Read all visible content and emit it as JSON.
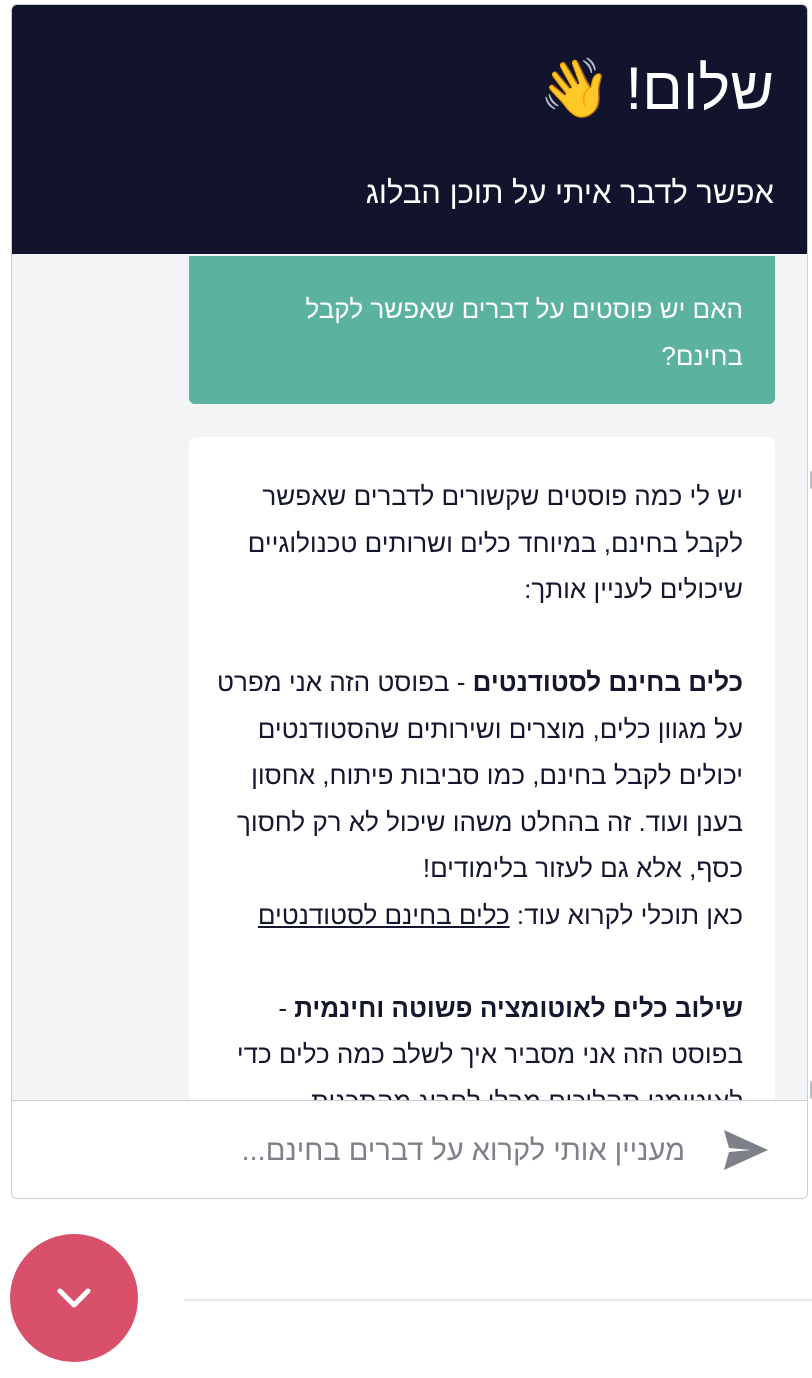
{
  "header": {
    "greeting": "שלום!",
    "wave_icon": "👋",
    "subtitle": "אפשר לדבר איתי על תוכן הבלוג"
  },
  "messages": {
    "user_question": "האם יש פוסטים על דברים שאפשר לקבל בחינם?",
    "bot_reply": {
      "intro": "יש לי כמה פוסטים שקשורים לדברים שאפשר לקבל בחינם, במיוחד כלים ושרותים טכנולוגיים שיכולים לעניין אותך:",
      "items": [
        {
          "title": "כלים בחינם לסטודנטים",
          "separator": " - ",
          "description": "בפוסט הזה אני מפרט על מגוון כלים, מוצרים ושירותים שהסטודנטים יכולים לקבל בחינם, כמו סביבות פיתוח, אחסון בענן ועוד. זה בהחלט משהו שיכול לא רק לחסוך כסף, אלא גם לעזור בלימודים!",
          "read_more_prefix": "כאן תוכלי לקרוא עוד: ",
          "link_text": "כלים בחינם לסטודנטים"
        },
        {
          "title": "שילוב כלים לאוטומציה פשוטה וחינמית",
          "separator": " - ",
          "description": "בפוסט הזה אני מסביר איך לשלב כמה כלים כדי לאוטומט תהליכים מבלי לחרוג מהתכנית"
        }
      ]
    }
  },
  "input": {
    "placeholder": "מעניין אותי לקרוא על דברים בחינם...",
    "value": ""
  },
  "icons": {
    "send": "send-icon",
    "toggle": "chevron-down-icon"
  },
  "colors": {
    "header_bg": "#12142e",
    "user_bubble": "#5bb39f",
    "toggle_button": "#d8506a",
    "chat_bg": "#f3f4f6"
  }
}
